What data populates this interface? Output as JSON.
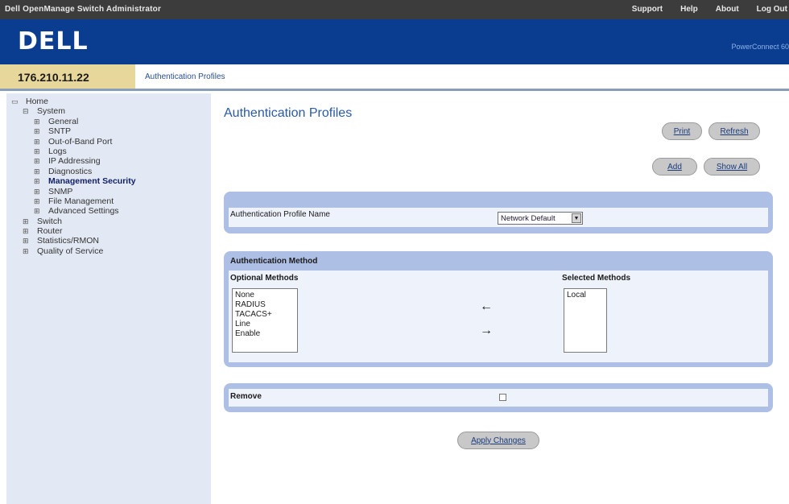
{
  "topbar": {
    "app_title": "Dell OpenManage Switch Administrator",
    "links": [
      "Support",
      "Help",
      "About",
      "Log Out"
    ]
  },
  "brand": {
    "logo": "DELL",
    "product": "PowerConnect 60"
  },
  "header": {
    "ip": "176.210.11.22",
    "breadcrumb": "Authentication Profiles"
  },
  "sidebar": {
    "home": "Home",
    "system": "System",
    "system_items": [
      "General",
      "SNTP",
      "Out-of-Band Port",
      "Logs",
      "IP Addressing",
      "Diagnostics",
      "Management Security",
      "SNMP",
      "File Management",
      "Advanced Settings"
    ],
    "top_items": [
      "Switch",
      "Router",
      "Statistics/RMON",
      "Quality of Service"
    ]
  },
  "main": {
    "title": "Authentication Profiles",
    "buttons": {
      "print": "Print",
      "refresh": "Refresh",
      "add": "Add",
      "show_all": "Show All",
      "apply": "Apply Changes"
    },
    "profile_name_label": "Authentication Profile Name",
    "profile_name_value": "Network Default",
    "method_section_title": "Authentication Method",
    "optional_methods_label": "Optional Methods",
    "selected_methods_label": "Selected Methods",
    "optional_methods": [
      "None",
      "RADIUS",
      "TACACS+",
      "Line",
      "Enable"
    ],
    "selected_methods": [
      "Local"
    ],
    "remove_label": "Remove",
    "arrow_left": "←",
    "arrow_right": "→"
  }
}
